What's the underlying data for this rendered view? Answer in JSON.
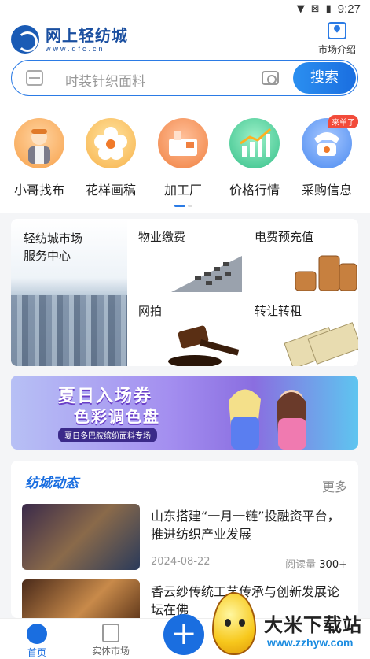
{
  "status_bar": {
    "time": "9:27"
  },
  "header": {
    "logo_title": "网上轻纺城",
    "logo_sub": "www.qfc.cn",
    "market_intro": "市场介绍"
  },
  "search": {
    "placeholder": "时装针织面料",
    "button": "搜索"
  },
  "quick_nav": [
    {
      "label": "小哥找布",
      "icon": "delivery-man-icon",
      "color": "#f7a14a"
    },
    {
      "label": "花样画稿",
      "icon": "flower-icon",
      "color": "#f7b24a"
    },
    {
      "label": "加工厂",
      "icon": "factory-icon",
      "color": "#f08040"
    },
    {
      "label": "价格行情",
      "icon": "chart-icon",
      "color": "#34c08a"
    },
    {
      "label": "采购信息",
      "icon": "phone-icon",
      "color": "#4a8af0",
      "badge": "来单了"
    }
  ],
  "services": {
    "main_title": "轻纺城市场\n服务中心",
    "cells": [
      {
        "title": "物业缴费",
        "icon": "calculator-icon"
      },
      {
        "title": "电费预充值",
        "icon": "coins-icon"
      },
      {
        "title": "网拍",
        "icon": "gavel-icon"
      },
      {
        "title": "转让转租",
        "icon": "banknotes-icon"
      }
    ]
  },
  "banner": {
    "line1": "夏日入场券",
    "line2": "色彩调色盘",
    "sub": "夏日多巴胺缤纷面料专场"
  },
  "news": {
    "title": "纺城动态",
    "more": "更多",
    "items": [
      {
        "headline": "山东搭建“一月一链”投融资平台，推进纺织产业发展",
        "date": "2024-08-22",
        "views_label": "阅读量",
        "views": "300+"
      },
      {
        "headline": "香云纱传统工艺传承与创新发展论坛在佛",
        "date": "",
        "views_label": "",
        "views": ""
      }
    ]
  },
  "tabbar": {
    "home": "首页",
    "market": "实体市场"
  },
  "watermark": {
    "name": "大米下载站",
    "url": "www.zzhyw.com"
  },
  "colors": {
    "brand": "#1a6ee0",
    "accent_red": "#f24b3a"
  }
}
